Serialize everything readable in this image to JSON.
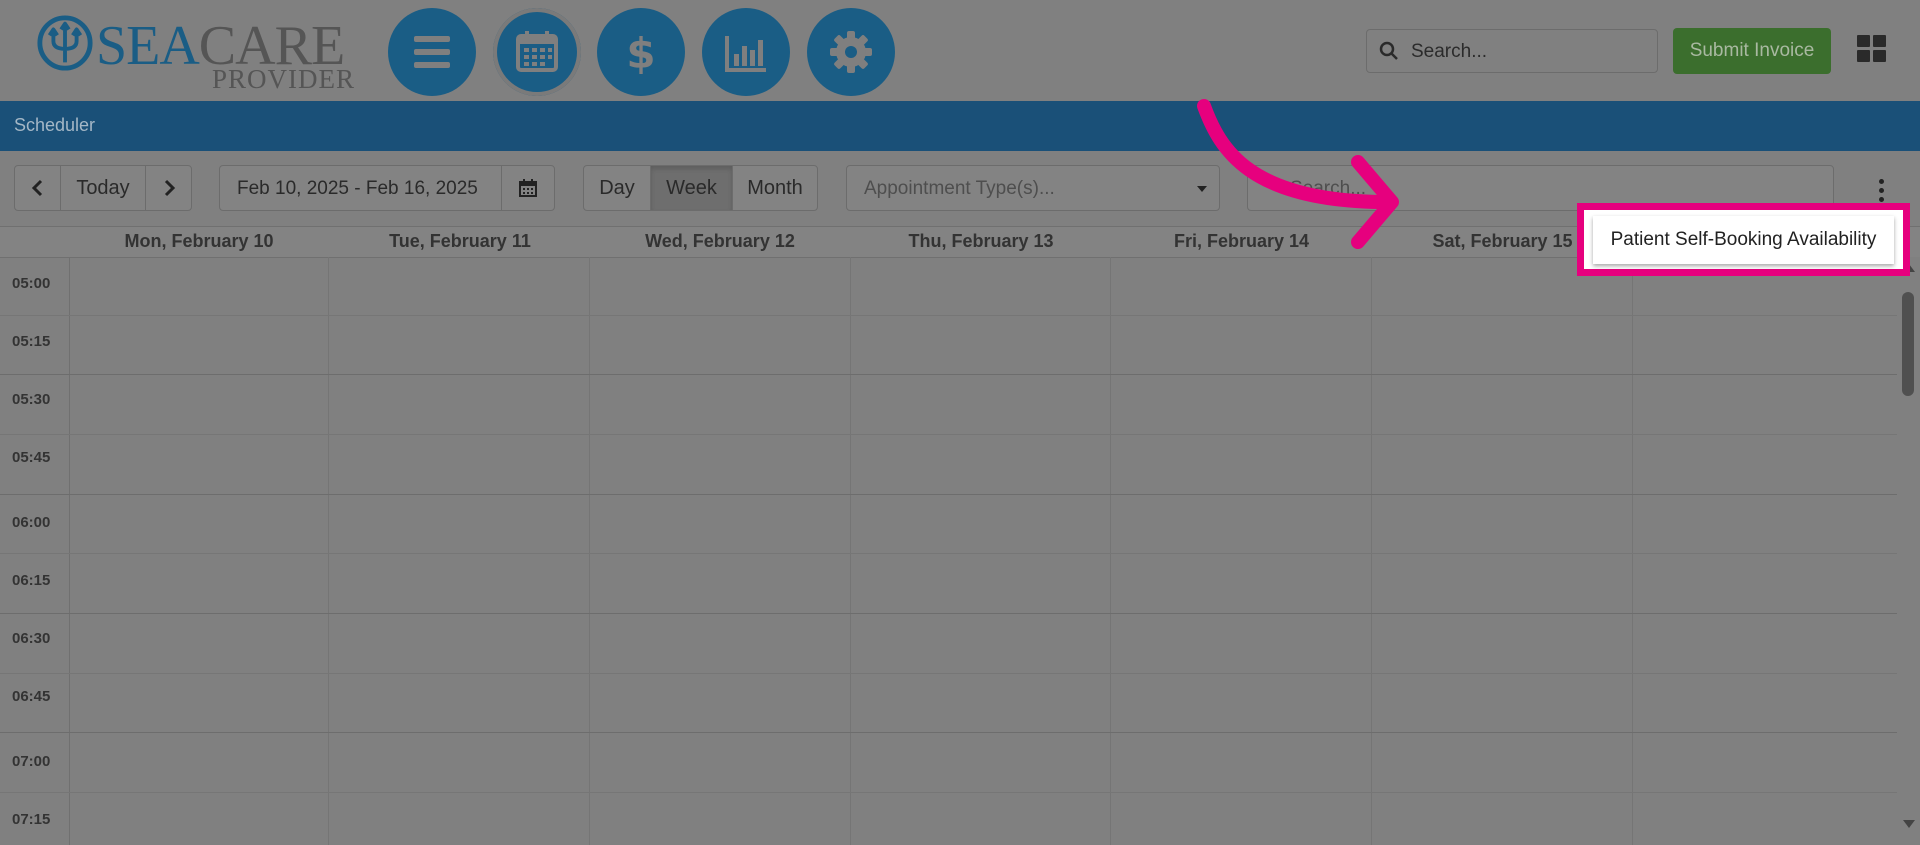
{
  "brand": {
    "name_part1": "SEA",
    "name_part2": "CARE",
    "sub": "PROVIDER",
    "primary_color": "#1a5d85",
    "accent_color": "#e6007e"
  },
  "nav": {
    "buttons": [
      {
        "name": "menu",
        "icon": "hamburger-icon"
      },
      {
        "name": "scheduler",
        "icon": "calendar-icon",
        "active": true
      },
      {
        "name": "billing",
        "icon": "dollar-icon"
      },
      {
        "name": "reports",
        "icon": "bar-chart-icon"
      },
      {
        "name": "settings",
        "icon": "gear-icon"
      }
    ]
  },
  "header": {
    "search_placeholder": "Search...",
    "submit_label": "Submit Invoice",
    "submit_color": "#3b6e2d"
  },
  "page": {
    "title": "Scheduler"
  },
  "toolbar": {
    "today_label": "Today",
    "date_range": "Feb 10, 2025 - Feb 16, 2025",
    "views": [
      "Day",
      "Week",
      "Month"
    ],
    "selected_view": "Week",
    "appointment_type_placeholder": "Appointment Type(s)...",
    "search_placeholder": "Search..."
  },
  "calendar": {
    "days": [
      "Mon, February 10",
      "Tue, February 11",
      "Wed, February 12",
      "Thu, February 13",
      "Fri, February 14",
      "Sat, February 15"
    ],
    "times": [
      "05:00",
      "05:15",
      "05:30",
      "05:45",
      "06:00",
      "06:15",
      "06:30",
      "06:45",
      "07:00",
      "07:15"
    ]
  },
  "dropdown": {
    "highlighted_item": "Patient Self-Booking Availability"
  }
}
